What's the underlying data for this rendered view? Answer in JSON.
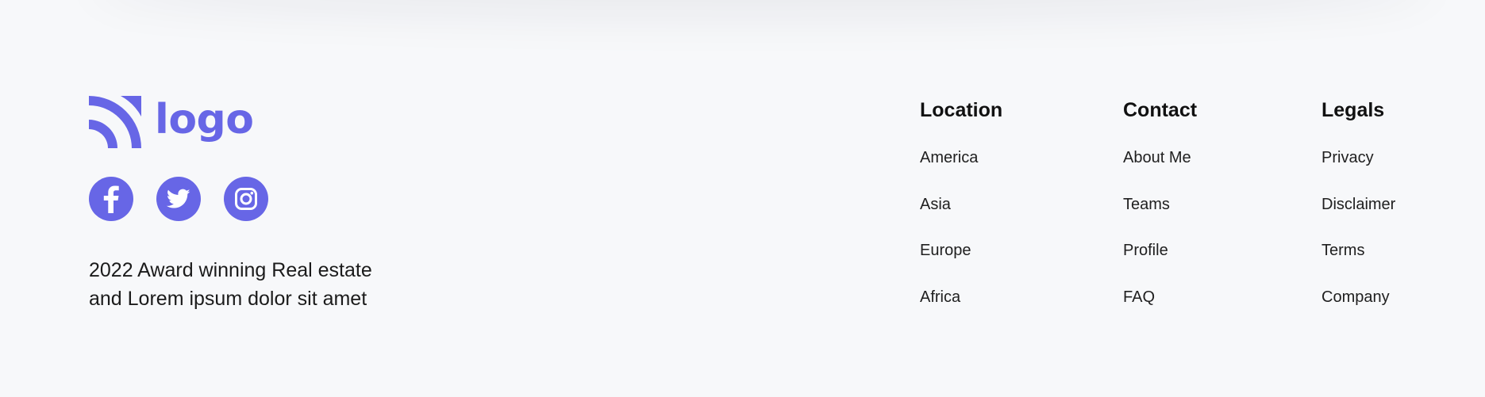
{
  "brand": {
    "logo_text": "logo",
    "logo_icon": "signal-waves-icon",
    "color": "#6766e6"
  },
  "social": [
    {
      "name": "facebook",
      "icon": "facebook-icon"
    },
    {
      "name": "twitter",
      "icon": "twitter-icon"
    },
    {
      "name": "instagram",
      "icon": "instagram-icon"
    }
  ],
  "tagline": {
    "line1": "2022 Award winning Real estate",
    "line2": "and Lorem ipsum dolor sit amet"
  },
  "columns": [
    {
      "title": "Location",
      "links": [
        "America",
        "Asia",
        "Europe",
        "Africa"
      ]
    },
    {
      "title": "Contact",
      "links": [
        "About Me",
        "Teams",
        "Profile",
        "FAQ"
      ]
    },
    {
      "title": "Legals",
      "links": [
        "Privacy",
        "Disclaimer",
        "Terms",
        "Company"
      ]
    }
  ],
  "colors": {
    "background": "#f7f8fa",
    "accent": "#6766e6",
    "text": "#161616"
  }
}
